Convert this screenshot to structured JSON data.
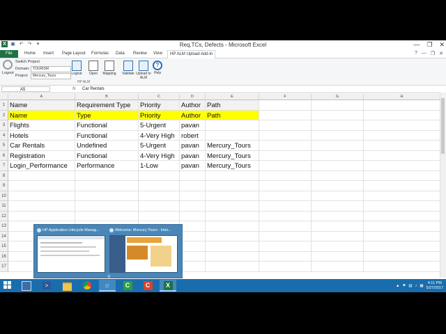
{
  "window": {
    "title": "Req,TCs, Defects - Microsoft Excel",
    "controls": [
      "?",
      "—",
      "❐",
      "✕"
    ]
  },
  "ribbon_tabs": [
    {
      "label": "File"
    },
    {
      "label": "Home"
    },
    {
      "label": "Insert"
    },
    {
      "label": "Page Layout"
    },
    {
      "label": "Formulas"
    },
    {
      "label": "Data"
    },
    {
      "label": "Review"
    },
    {
      "label": "View"
    },
    {
      "label": "HP ALM Upload Add-in"
    }
  ],
  "ribbon": {
    "logout_left_label": "Logout",
    "switch_project": "Switch Project",
    "domain_label": "Domain:",
    "domain_value": "TOURISM",
    "project_label": "Project:",
    "project_value": "Mercury_Tours",
    "buttons": [
      "Logout",
      "Open",
      "Mapping",
      "Validate",
      "Upload to ALM",
      "Help"
    ],
    "group_label": "HP ALM"
  },
  "formula_bar": {
    "cell_ref": "A5",
    "fx": "fx",
    "content": "Car Rentals"
  },
  "columns": [
    "A",
    "B",
    "C",
    "D",
    "E",
    "F",
    "G",
    "H"
  ],
  "rows": [
    "1",
    "2",
    "3",
    "4",
    "5",
    "6",
    "7",
    "8",
    "9",
    "10",
    "11",
    "12",
    "13",
    "14",
    "15",
    "16",
    "17"
  ],
  "sheet": [
    [
      "Name",
      "Requirement Type",
      "Priority",
      "Author",
      "Path"
    ],
    [
      "Name",
      "Type",
      "Priority",
      "Author",
      "Path"
    ],
    [
      "Flights",
      "Functional",
      "5-Urgent",
      "pavan",
      ""
    ],
    [
      "Hotels",
      "Functional",
      "4-Very High",
      "robert",
      ""
    ],
    [
      "Car Rentals",
      "Undefined",
      "5-Urgent",
      "pavan",
      "Mercury_Tours"
    ],
    [
      "Registration",
      "Functional",
      "4-Very High",
      "pavan",
      "Mercury_Tours"
    ],
    [
      "Login_Performance",
      "Performance",
      "1-Low",
      "pavan",
      "Mercury_Tours"
    ]
  ],
  "thumbnails": [
    {
      "title": "HP Application Lifecycle Manag..."
    },
    {
      "title": "Welcome: Mercury Tours - Inter..."
    }
  ],
  "taskbar": {
    "time": "4:11 PM",
    "date": "5/27/2017"
  },
  "colors": {
    "excel_green": "#1e7145",
    "highlight_yellow": "#ffff00",
    "taskbar_blue": "#1a6dad"
  }
}
